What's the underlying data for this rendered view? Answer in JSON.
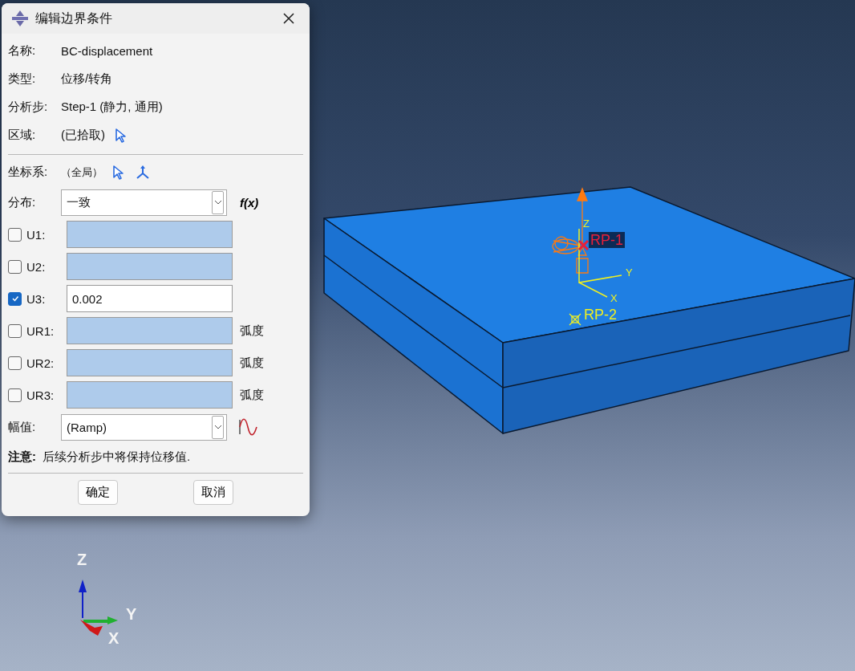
{
  "dialog": {
    "title": "编辑边界条件",
    "info_rows": [
      {
        "label": "名称:",
        "value": "BC-displacement",
        "kind": "plain"
      },
      {
        "label": "类型:",
        "value": "位移/转角",
        "kind": "plain"
      },
      {
        "label": "分析步:",
        "value": "Step-1 (静力, 通用)",
        "kind": "plain"
      },
      {
        "label": "区域:",
        "value": "(已拾取)",
        "kind": "pick"
      }
    ],
    "csys": {
      "label": "坐标系:",
      "value": "（全局）"
    },
    "distribution": {
      "label": "分布:",
      "value": "一致",
      "function_button": "f(x)"
    },
    "dofs": [
      {
        "label": "U1:",
        "checked": false
      },
      {
        "label": "U2:",
        "checked": false
      },
      {
        "label": "U3:",
        "checked": true,
        "value": "0.002"
      },
      {
        "label": "UR1:",
        "checked": false,
        "unit": "弧度"
      },
      {
        "label": "UR2:",
        "checked": false,
        "unit": "弧度"
      },
      {
        "label": "UR3:",
        "checked": false,
        "unit": "弧度"
      }
    ],
    "amplitude": {
      "label": "幅值:",
      "value": "(Ramp)"
    },
    "note": {
      "label": "注意:",
      "text": "后续分析步中将保持位移值."
    },
    "buttons": [
      "确定",
      "取消"
    ]
  },
  "viewport": {
    "reference_points": [
      {
        "label": "RP-1",
        "color": "#e8203a"
      },
      {
        "label": "RP-2",
        "color": "#f0f020"
      }
    ],
    "local_axes": {
      "z": "Z",
      "y": "Y",
      "x": "X"
    },
    "triad": {
      "z": "Z",
      "y": "Y",
      "x": "X"
    }
  }
}
